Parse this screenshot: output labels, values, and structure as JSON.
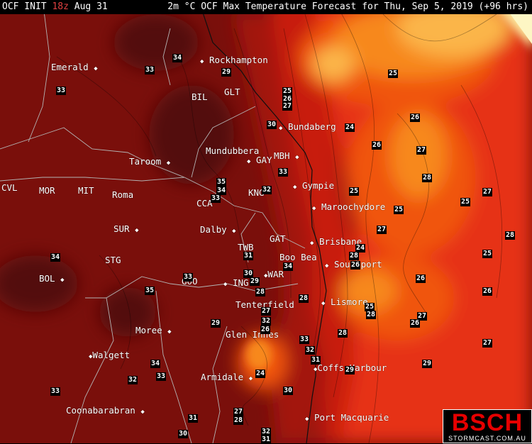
{
  "header": {
    "init_prefix": "OCF INIT",
    "init_hour": "18z",
    "init_date": "Aug 31",
    "title": "2m °C OCF Max Temperature Forecast for Thu, Sep 5, 2019 (+96 hrs)"
  },
  "colors": {
    "very_hot": "#520808",
    "hot": "#7a0f0b",
    "warm": "#a3170d",
    "mild_warm": "#c81e10",
    "mild": "#e63212",
    "cool_mild": "#f0540f",
    "cool": "#f7881b",
    "cooler": "#fbb548",
    "coolest": "#fce59a",
    "ocean_open": "#fdf6c4",
    "borders": "#b4b4b4",
    "coast": "#101010"
  },
  "cities": [
    {
      "name": "Rockhampton"
    },
    {
      "name": "Emerald"
    },
    {
      "name": "GLT"
    },
    {
      "name": "BIL"
    },
    {
      "name": "Bundaberg"
    },
    {
      "name": "Mundubbera"
    },
    {
      "name": "MBH"
    },
    {
      "name": "Taroom"
    },
    {
      "name": "GAY"
    },
    {
      "name": "Gympie"
    },
    {
      "name": "CVL"
    },
    {
      "name": "MOR"
    },
    {
      "name": "MIT"
    },
    {
      "name": "Roma"
    },
    {
      "name": "CCA"
    },
    {
      "name": "KNG"
    },
    {
      "name": "Maroochydore"
    },
    {
      "name": "SUR"
    },
    {
      "name": "Dalby"
    },
    {
      "name": "GAT"
    },
    {
      "name": "TWB"
    },
    {
      "name": "Brisbane"
    },
    {
      "name": "Boo Bea"
    },
    {
      "name": "Southport"
    },
    {
      "name": "STG"
    },
    {
      "name": "BOL"
    },
    {
      "name": "WAR"
    },
    {
      "name": "GOO"
    },
    {
      "name": "ING"
    },
    {
      "name": "Tenterfield"
    },
    {
      "name": "Lismore"
    },
    {
      "name": "Moree"
    },
    {
      "name": "Glen Innes"
    },
    {
      "name": "Walgett"
    },
    {
      "name": "Coffs Harbour"
    },
    {
      "name": "Armidale"
    },
    {
      "name": "Coonabarabran"
    },
    {
      "name": "Port Macquarie"
    }
  ],
  "contour_labels": [
    "34",
    "29",
    "33",
    "33",
    "25",
    "26",
    "27",
    "30",
    "24",
    "25",
    "26",
    "27",
    "26",
    "33",
    "35",
    "34",
    "33",
    "32",
    "25",
    "25",
    "27",
    "28",
    "25",
    "27",
    "28",
    "24",
    "34",
    "31",
    "28",
    "26",
    "25",
    "33",
    "35",
    "30",
    "29",
    "34",
    "26",
    "26",
    "28",
    "27",
    "25",
    "28",
    "27",
    "26",
    "29",
    "32",
    "26",
    "28",
    "33",
    "32",
    "34",
    "31",
    "24",
    "29",
    "33",
    "32",
    "27",
    "33",
    "30",
    "31",
    "28",
    "30",
    "32",
    "31",
    "27",
    "29",
    "28"
  ],
  "logo": {
    "brand": "BSCH",
    "site": "STORMCAST.COM.AU"
  }
}
